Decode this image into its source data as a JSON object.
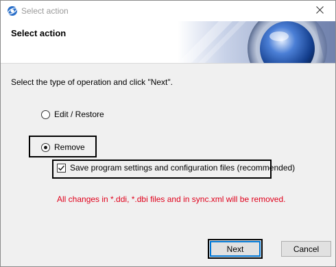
{
  "window": {
    "title": "Select action",
    "banner_title": "Select action"
  },
  "content": {
    "instruction": "Select the type of operation and click \"Next\".",
    "options": [
      {
        "label": "Edit / Restore",
        "checked": false
      },
      {
        "label": "Remove",
        "checked": true
      }
    ],
    "save_settings": {
      "label": "Save program settings and configuration files (recommended)",
      "checked": true
    },
    "warning": "All changes in *.ddi, *.dbi files and in sync.xml will be removed."
  },
  "buttons": {
    "next": "Next",
    "cancel": "Cancel"
  },
  "colors": {
    "warning": "#e0001b",
    "focus": "#0078d7"
  },
  "icons": {
    "app": "app-logo-icon",
    "close": "close-icon"
  }
}
